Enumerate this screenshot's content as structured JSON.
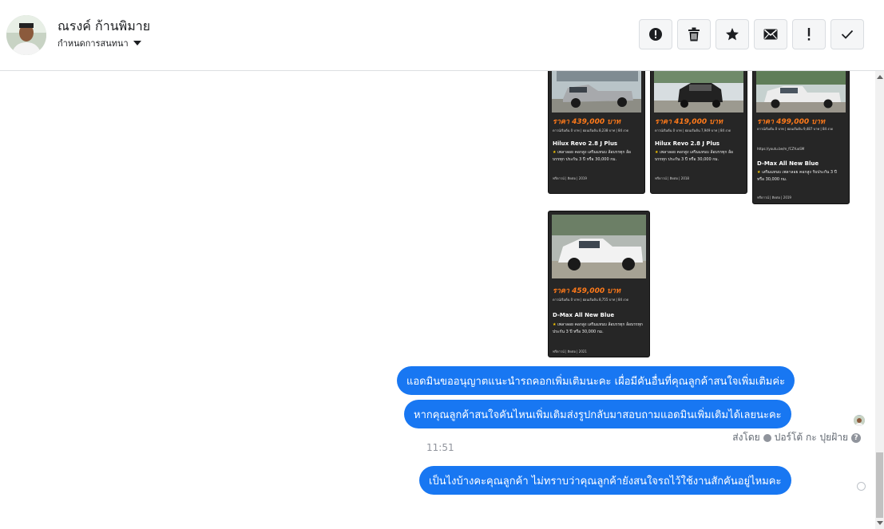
{
  "header": {
    "contact_name": "ณรงค์ ก้านพิมาย",
    "assign_label": "กำหนดการสนทนา",
    "toolbar": [
      "alert-circle-icon",
      "trash-icon",
      "star-icon",
      "envelope-icon",
      "exclamation-icon",
      "check-icon"
    ]
  },
  "cards": [
    {
      "price": "ราคา 439,000 บาท",
      "sub": "ดาวน์เริ่มต้น 0 บาท | ผ่อนเริ่มต้น 8,238 บาท | 84 งวด",
      "model": "Hilux Revo 2.8 J Plus",
      "desc": "เพลาลอย คอกสูง เสริมแหนบ ล้อบรรทุก ล้อบรรทุก ประกัน 3 ปี หรือ 30,000 กม.",
      "foot": "ฟรีดาวน์ | ติดต่อ | 2019"
    },
    {
      "price": "ราคา 419,000 บาท",
      "sub": "ดาวน์เริ่มต้น 0 บาท | ผ่อนเริ่มต้น 7,949 บาท | 84 งวด",
      "model": "Hilux Revo 2.8 J Plus",
      "desc": "เพลาลอย คอกสูง เสริมแหนบ ล้อบรรทุก ล้อบรรทุก ประกัน 3 ปี หรือ 30,000 กม.",
      "foot": "ฟรีดาวน์ | ติดต่อ | 2018"
    },
    {
      "price": "ราคา 499,000 บาท",
      "sub": "ดาวน์เริ่มต้น 0 บาท | ผ่อนเริ่มต้น 9,487 บาท | 84 งวด",
      "extra": "https://youtu.be/m_fCZYuoSM",
      "model": "D-Max All New Blue",
      "desc": "เสริมแหนบ เพลาลอย คอกสูง รับประกัน 3 ปี หรือ 30,000 กม.",
      "foot": "ฟรีดาวน์ | ติดต่อ | 2019"
    },
    {
      "price": "ราคา 459,000 บาท",
      "sub": "ดาวน์เริ่มต้น 0 บาท | ผ่อนเริ่มต้น 8,755 บาท | 84 งวด",
      "model": "D-Max All New Blue",
      "desc": "เพลาลอย คอกสูง เสริมแหนบ ล้อบรรทุก ล้อบรรทุก ประกัน 3 ปี หรือ 30,000 กม.",
      "foot": "ฟรีดาวน์ | ติดต่อ | 2021"
    }
  ],
  "messages": [
    "แอดมินขออนุญาตแนะนำรถคอกเพิ่มเติมนะคะ เผื่อมีคันอื่นที่คุณลูกค้าสนใจเพิ่มเติมค่ะ",
    "หากคุณลูกค้าสนใจคันไหนเพิ่มเติมส่งรูปกลับมาสอบถามแอดมินเพิ่มเติมได้เลยนะคะ",
    "เป็นไงบ้างคะคุณลูกค้า ไม่ทราบว่าคุณลูกค้ายังสนใจรถไว้ใช้งานสักคันอยู่ไหมคะ"
  ],
  "timestamp": "11:51",
  "sent_by": {
    "label": "ส่งโดย",
    "name": "ปอร์โต้ กะ ปุยฝ้าย"
  },
  "colors": {
    "bubble": "#1877f2",
    "card_bg": "#262626",
    "price": "#ff7a1a"
  }
}
